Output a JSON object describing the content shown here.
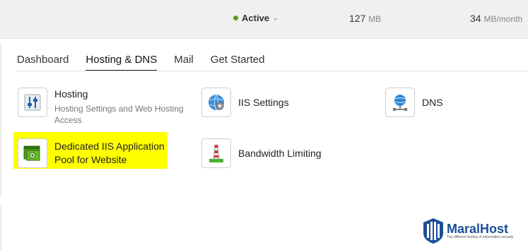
{
  "topbar": {
    "status_label": "Active",
    "storage": {
      "value": "127",
      "unit": "MB"
    },
    "traffic": {
      "value": "34",
      "unit": "MB/month"
    }
  },
  "tabs": [
    {
      "label": "Dashboard"
    },
    {
      "label": "Hosting & DNS"
    },
    {
      "label": "Mail"
    },
    {
      "label": "Get Started"
    }
  ],
  "tiles": {
    "hosting": {
      "title": "Hosting",
      "subtitle": "Hosting Settings and Web Hosting Access"
    },
    "iis": {
      "title": "IIS Settings"
    },
    "dns": {
      "title": "DNS"
    },
    "pool": {
      "title_line1": "Dedicated IIS Application",
      "title_line2": "Pool for Website"
    },
    "bandwidth": {
      "title": "Bandwidth Limiting"
    }
  },
  "brand": {
    "name": "MaralHost",
    "tagline": "The different feeling of information security"
  },
  "colors": {
    "highlight": "#ffff00",
    "status": "#5a9a1f",
    "brand": "#1d4e97"
  },
  "icons": {
    "hosting": "sliders-icon",
    "iis": "globe-gear-icon",
    "dns": "globe-network-icon",
    "pool": "window-gear-icon",
    "bandwidth": "lighthouse-icon"
  }
}
